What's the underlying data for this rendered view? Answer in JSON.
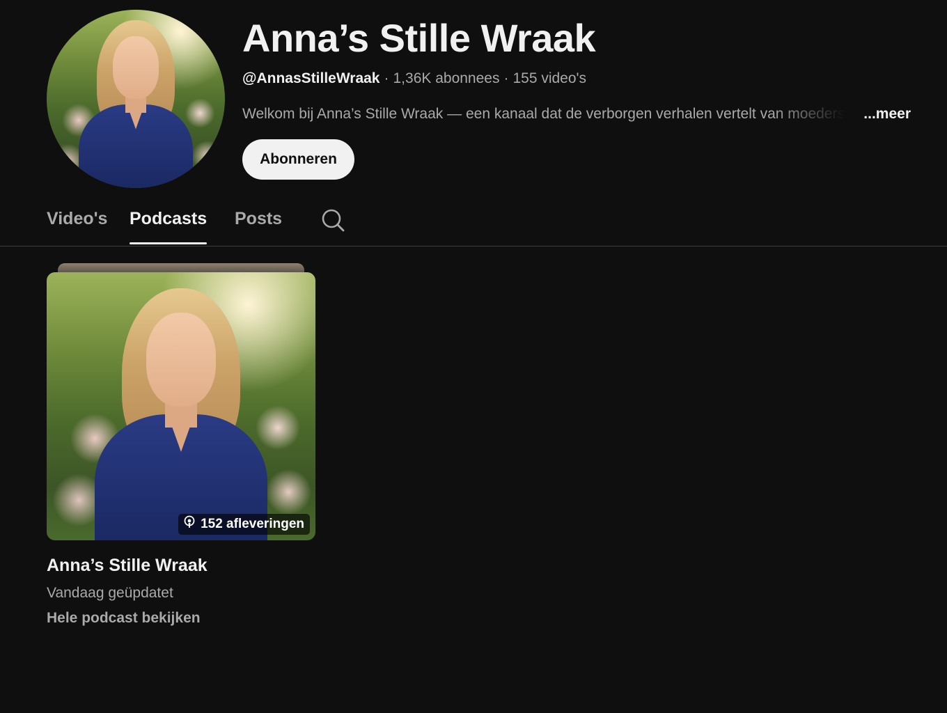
{
  "channel": {
    "title": "Anna’s Stille Wraak",
    "handle": "@AnnasStilleWraak",
    "subscribers": "1,36K abonnees",
    "videos": "155 video's",
    "description": "Welkom bij Anna’s Stille Wraak — een kanaal dat de verborgen verhalen vertelt van moeders",
    "more_label": "...meer",
    "subscribe_label": "Abonneren",
    "avatar_icon": "channel-avatar-portrait"
  },
  "tabs": [
    {
      "label": "Video's",
      "active": false
    },
    {
      "label": "Podcasts",
      "active": true
    },
    {
      "label": "Posts",
      "active": false
    }
  ],
  "search_icon": "search-icon",
  "podcast": {
    "title": "Anna’s Stille Wraak",
    "episodes": "152 afleveringen",
    "updated": "Vandaag geüpdatet",
    "link_label": "Hele podcast bekijken",
    "badge_icon": "podcast-icon"
  },
  "colors": {
    "background": "#0f0f0f",
    "text_primary": "#f1f1f1",
    "text_secondary": "#aaaaaa",
    "divider": "#3f3f3f",
    "button_bg": "#f1f1f1"
  }
}
